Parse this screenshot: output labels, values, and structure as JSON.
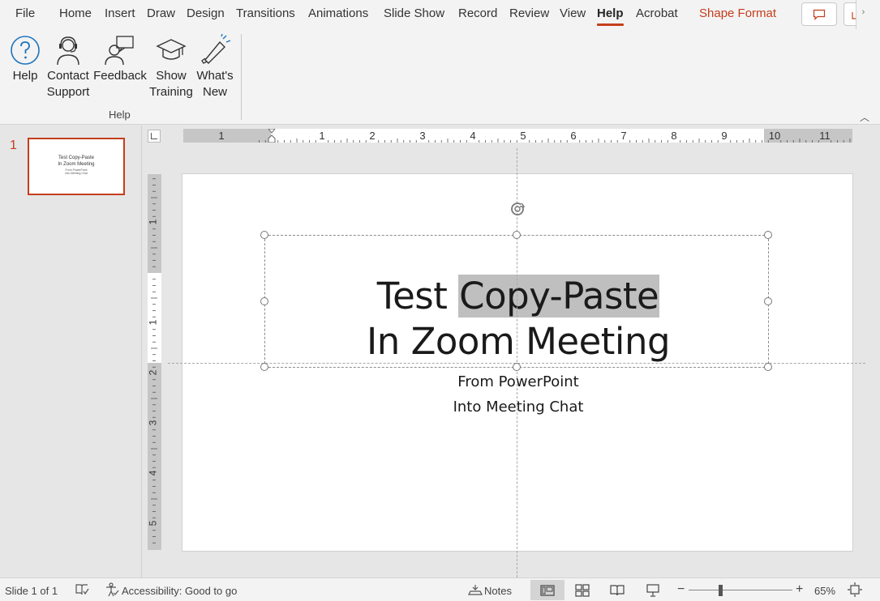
{
  "tabs": [
    {
      "label": "File"
    },
    {
      "label": "Home"
    },
    {
      "label": "Insert"
    },
    {
      "label": "Draw"
    },
    {
      "label": "Design"
    },
    {
      "label": "Transitions"
    },
    {
      "label": "Animations"
    },
    {
      "label": "Slide Show"
    },
    {
      "label": "Record"
    },
    {
      "label": "Review"
    },
    {
      "label": "View"
    },
    {
      "label": "Help"
    },
    {
      "label": "Acrobat"
    },
    {
      "label": "Shape Format"
    }
  ],
  "active_tab": "Help",
  "ribbon": {
    "buttons": [
      {
        "label": "Help",
        "icon": "help-circle-icon"
      },
      {
        "label": "Contact Support",
        "icon": "headset-person-icon"
      },
      {
        "label": "Feedback",
        "icon": "feedback-person-icon"
      },
      {
        "label": "Show Training",
        "icon": "graduation-cap-icon"
      },
      {
        "label": "What's New",
        "icon": "megaphone-icon"
      }
    ],
    "group_label": "Help"
  },
  "thumbnails": [
    {
      "number": "1",
      "title_line1": "Test Copy-Paste",
      "title_line2": "In Zoom Meeting",
      "sub_line1": "From PowerPoint",
      "sub_line2": "Into Meeting Chat"
    }
  ],
  "ruler": {
    "horizontal_labels": [
      "1",
      "1",
      "2",
      "3",
      "4",
      "5",
      "6",
      "7",
      "8",
      "9",
      "10",
      "11"
    ],
    "vertical_labels": [
      "1",
      "1",
      "2",
      "3",
      "4",
      "5"
    ]
  },
  "slide": {
    "title_line1_plain": "Test ",
    "title_line1_selected": "Copy-Paste",
    "title_line2": "In Zoom Meeting",
    "subtitle_line1": "From PowerPoint",
    "subtitle_line2": "Into Meeting Chat"
  },
  "status": {
    "slide_info": "Slide 1 of 1",
    "accessibility": "Accessibility: Good to go",
    "notes": "Notes",
    "zoom": "65%",
    "zoom_minus": "−",
    "zoom_plus": "+"
  },
  "colors": {
    "accent": "#c43e1c",
    "selection": "#bfbfbf",
    "ribbon_bg": "#f3f3f3"
  }
}
